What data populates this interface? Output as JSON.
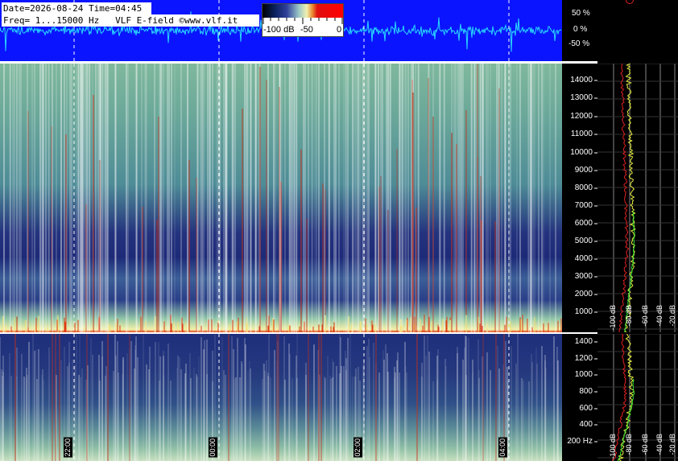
{
  "header": {
    "date_time": "Date=2026-08-24 Time=04:45",
    "freq_info": "Freq= 1...15000 Hz   VLF E-field ©www.vlf.it"
  },
  "colorbar": {
    "labels": [
      "-100 dB",
      "-50",
      "0"
    ]
  },
  "waveform_scale": [
    "50 %",
    "0 %",
    "-50 %"
  ],
  "main_spectrogram": {
    "freq_ticks": [
      "14000",
      "13000",
      "12000",
      "11000",
      "10000",
      "9000",
      "8000",
      "7000",
      "6000",
      "5000",
      "4000",
      "3000",
      "2000",
      "1000"
    ],
    "profile_db_labels": [
      "-100 dB",
      "-80 dB",
      "-60 dB",
      "-40 dB",
      "-20 dB"
    ]
  },
  "low_spectrogram": {
    "freq_ticks": [
      "1400",
      "1200",
      "1000",
      "800",
      "600",
      "400",
      "200 Hz"
    ],
    "profile_db_labels": [
      "-100 dB",
      "-80 dB",
      "-60 dB",
      "-40 dB",
      "-20 dB"
    ]
  },
  "time_labels": [
    "22:00",
    "00:00",
    "02:00",
    "04:00"
  ],
  "colors": {
    "wave_bg": "#0a14ff",
    "wave_trace": "#28d8ff",
    "profile_yellow": "#e8f040",
    "profile_red": "#e02020",
    "profile_green": "#30e030"
  }
}
